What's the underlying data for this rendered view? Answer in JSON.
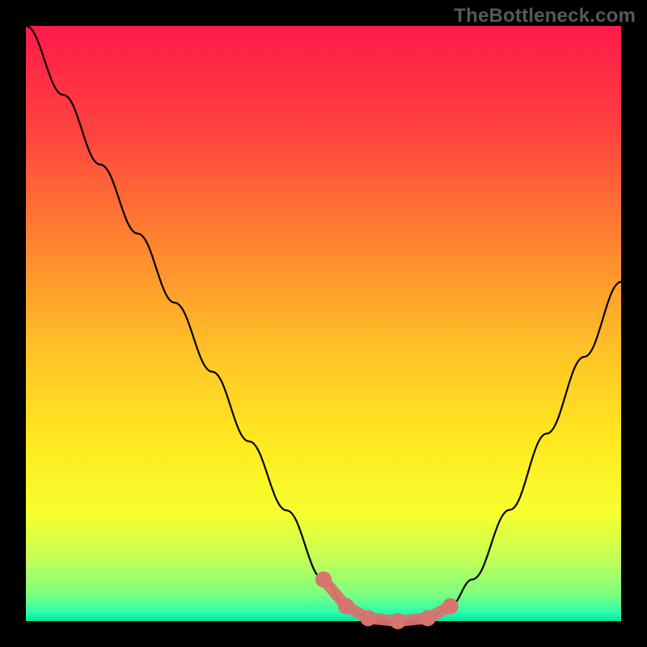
{
  "watermark": "TheBottleneck.com",
  "chart_data": {
    "type": "line",
    "title": "",
    "xlabel": "",
    "ylabel": "",
    "xlim": [
      0,
      100
    ],
    "ylim": [
      0,
      100
    ],
    "grid": false,
    "legend": false,
    "background_gradient_stops": [
      {
        "offset": 0.0,
        "color": "#ff1a4a"
      },
      {
        "offset": 0.18,
        "color": "#ff433f"
      },
      {
        "offset": 0.38,
        "color": "#ff8a2e"
      },
      {
        "offset": 0.55,
        "color": "#ffc427"
      },
      {
        "offset": 0.7,
        "color": "#ffe91f"
      },
      {
        "offset": 0.82,
        "color": "#f7ff2e"
      },
      {
        "offset": 0.9,
        "color": "#beff58"
      },
      {
        "offset": 0.955,
        "color": "#7cff80"
      },
      {
        "offset": 0.985,
        "color": "#2bffab"
      },
      {
        "offset": 1.0,
        "color": "#00e39a"
      }
    ],
    "series": [
      {
        "name": "curve",
        "color": "#000000",
        "x": [
          0.0,
          6.3,
          12.5,
          18.8,
          25.0,
          31.3,
          37.5,
          43.8,
          50.0,
          53.8,
          57.5,
          62.5,
          67.5,
          71.3,
          75.0,
          81.3,
          87.5,
          93.8,
          100.0
        ],
        "y": [
          100.0,
          88.4,
          76.7,
          65.1,
          53.5,
          41.9,
          30.2,
          18.6,
          7.0,
          2.5,
          0.5,
          0.0,
          0.5,
          2.5,
          7.0,
          18.7,
          31.5,
          44.4,
          57.0
        ]
      },
      {
        "name": "highlight-dots",
        "color": "#d8736f",
        "type": "scatter",
        "x": [
          50.0,
          53.8,
          57.5,
          62.5,
          67.5,
          71.3
        ],
        "y": [
          7.0,
          2.5,
          0.5,
          0.0,
          0.5,
          2.5
        ]
      }
    ]
  }
}
